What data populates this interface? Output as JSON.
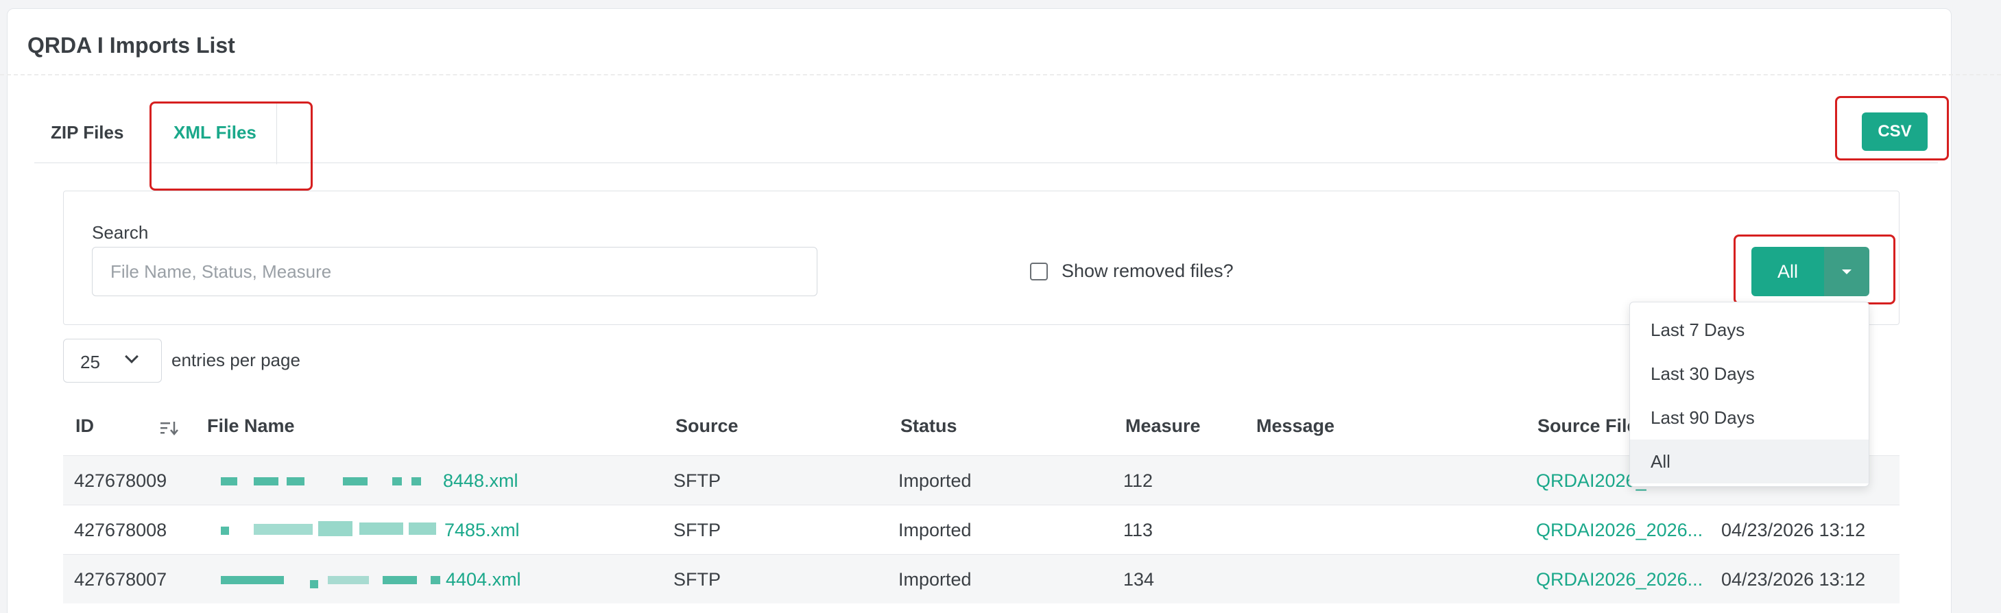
{
  "page": {
    "title": "QRDA I Imports List"
  },
  "tabs": [
    {
      "label": "ZIP Files",
      "active": false
    },
    {
      "label": "XML Files",
      "active": true
    }
  ],
  "toolbar": {
    "csv_label": "CSV"
  },
  "filters": {
    "search_label": "Search",
    "search_placeholder": "File Name, Status, Measure",
    "search_value": "",
    "show_removed_label": "Show removed files?",
    "show_removed_checked": false,
    "range_button_label": "All",
    "range_options": [
      "Last 7 Days",
      "Last 30 Days",
      "Last 90 Days",
      "All"
    ],
    "range_selected": "All"
  },
  "pagination": {
    "per_page_value": "25",
    "per_page_label": "entries per page"
  },
  "table": {
    "columns": [
      "ID",
      "File Name",
      "Source",
      "Status",
      "Measure",
      "Message",
      "Source File"
    ],
    "rows": [
      {
        "id": "427678009",
        "file_name_suffix": "8448.xml",
        "source": "SFTP",
        "status": "Imported",
        "measure": "112",
        "message": "",
        "source_file": "QRDAI2026_",
        "date": ""
      },
      {
        "id": "427678008",
        "file_name_suffix": "7485.xml",
        "source": "SFTP",
        "status": "Imported",
        "measure": "113",
        "message": "",
        "source_file": "QRDAI2026_2026...",
        "date": "04/23/2026 13:12"
      },
      {
        "id": "427678007",
        "file_name_suffix": "4404.xml",
        "source": "SFTP",
        "status": "Imported",
        "measure": "134",
        "message": "",
        "source_file": "QRDAI2026_2026...",
        "date": "04/23/2026 13:12"
      }
    ]
  },
  "colors": {
    "accent": "#1aa88a",
    "highlight": "#d61f1f"
  }
}
